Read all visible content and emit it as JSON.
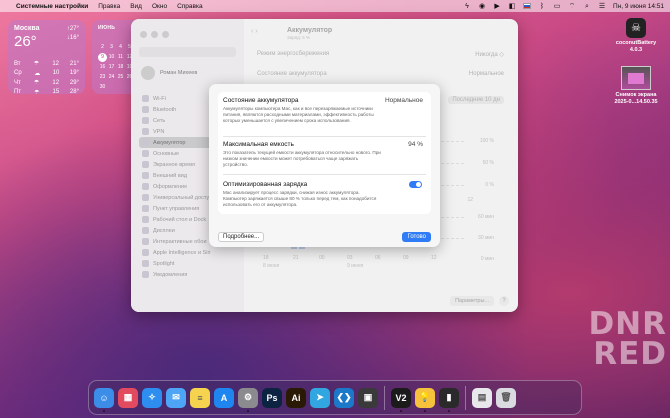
{
  "menubar": {
    "app_name": "Системные настройки",
    "items": [
      "Правка",
      "Вид",
      "Окно",
      "Справка"
    ],
    "datetime": "Пн, 9 июня  14:51",
    "status_icons": [
      "bolt-icon",
      "sphere-icon",
      "play-icon",
      "control-icon",
      "flag-icon",
      "bluetooth-icon",
      "battery-icon",
      "wifi-icon",
      "search-icon",
      "control-center-icon"
    ]
  },
  "weather": {
    "city": "Москва",
    "temp": "26°",
    "hi": "↑27°",
    "lo": "↓16°",
    "rows": [
      {
        "day": "Вт",
        "icon": "cloud-rain-icon",
        "lo": "12",
        "hi": "21°"
      },
      {
        "day": "Ср",
        "icon": "cloud-sun-icon",
        "lo": "10",
        "hi": "19°"
      },
      {
        "day": "Чт",
        "icon": "cloud-rain-icon",
        "lo": "12",
        "hi": "29°"
      },
      {
        "day": "Пт",
        "icon": "cloud-rain-icon",
        "lo": "15",
        "hi": "28°"
      }
    ]
  },
  "calendar": {
    "month": "ИЮНЬ",
    "today": "9",
    "days": [
      "",
      "",
      "",
      "",
      "",
      "",
      "1",
      "2",
      "3",
      "4",
      "5",
      "6",
      "7",
      "8",
      "9",
      "10",
      "11",
      "12",
      "13",
      "14",
      "15",
      "16",
      "17",
      "18",
      "19",
      "20",
      "21",
      "22",
      "23",
      "24",
      "25",
      "26",
      "27",
      "28",
      "29",
      "30"
    ]
  },
  "desktop": {
    "coconut_label": "coconutBattery",
    "coconut_version": "4.0.3",
    "screenshot_label": "Снимок экрана",
    "screenshot_sub": "2025-0...14.50.35"
  },
  "window": {
    "title": "Аккумулятор",
    "subtitle": "Заряд: 6 %",
    "profile_name": "Роман Михеев",
    "sidebar_items": [
      "Wi-Fi",
      "Bluetooth",
      "Сеть",
      "VPN",
      "Аккумулятор",
      "Основные",
      "Экранное время",
      "Внешний вид",
      "Оформление",
      "Универсальный доступ",
      "Пункт управления",
      "Рабочий стол и Dock",
      "Дисплеи",
      "Интерактивные обои",
      "Apple Intelligence и Siri",
      "Spotlight",
      "Уведомления"
    ],
    "active_item": "Аккумулятор",
    "row1_label": "Режим энергосбережения",
    "row1_value": "Никогда ◇",
    "row2_label": "Состояние аккумулятора",
    "row2_value": "Нормальное",
    "tabs_label": "Последние 10 дн",
    "pct_labels": [
      "100 %",
      "50 %",
      "0 %",
      "12",
      "60 мин",
      "30 мин",
      "0 мин"
    ],
    "x_labels": [
      "18",
      "21",
      "00",
      "03",
      "06",
      "09",
      "12"
    ],
    "x_sub": "8 июня",
    "x_sub2": "9 июня",
    "params_label": "Параметры...",
    "help_label": "?"
  },
  "sheet": {
    "health_title": "Состояние аккумулятора",
    "health_value": "Нормальное",
    "health_desc": "Аккумуляторы компьютера Mac, как и все перезаряжаемые источники питания, являются расходными материалами, эффективность работы которых уменьшается с увеличением срока использования.",
    "capacity_title": "Максимальная емкость",
    "capacity_value": "94 %",
    "capacity_desc": "Это показатель текущей емкости аккумулятора относительно нового. При низком значении емкости может потребоваться чаще заряжать устройство.",
    "optimized_title": "Оптимизированная зарядка",
    "optimized_desc": "Mac анализирует процесс зарядки, снижая износ аккумулятора. Компьютер заряжается свыше 80 % только перед тем, как понадобится использовать его от аккумулятора.",
    "optimized_on": true,
    "more_label": "Подробнее...",
    "done_label": "Готово"
  },
  "dock": {
    "apps": [
      {
        "name": "finder-icon",
        "color": "#3b8de8",
        "glyph": "☺"
      },
      {
        "name": "launchpad-icon",
        "color": "#e24b5f",
        "glyph": "▦"
      },
      {
        "name": "safari-icon",
        "color": "#2d8ef0",
        "glyph": "✧"
      },
      {
        "name": "mail-icon",
        "color": "#4ea4f5",
        "glyph": "✉"
      },
      {
        "name": "notes-icon",
        "color": "#f5d34e",
        "glyph": "≡"
      },
      {
        "name": "app-store-icon",
        "color": "#1f86f0",
        "glyph": "A"
      },
      {
        "name": "system-settings-icon",
        "color": "#8a8a8f",
        "glyph": "⚙"
      },
      {
        "name": "photoshop-icon",
        "color": "#0c2342",
        "glyph": "Ps"
      },
      {
        "name": "illustrator-icon",
        "color": "#2a1a05",
        "glyph": "Ai"
      },
      {
        "name": "telegram-icon",
        "color": "#32a6e0",
        "glyph": "➤"
      },
      {
        "name": "vscode-icon",
        "color": "#1c78c8",
        "glyph": "❮❯"
      },
      {
        "name": "pdf-reader-icon",
        "color": "#3a3a3a",
        "glyph": "▣"
      }
    ],
    "recent": [
      {
        "name": "v2-app-icon",
        "color": "#1b1b1b",
        "glyph": "V2"
      },
      {
        "name": "bulb-app-icon",
        "color": "#f6c23b",
        "glyph": "💡"
      },
      {
        "name": "coconut-battery-icon",
        "color": "#2a2a2a",
        "glyph": "▮"
      }
    ],
    "trailing": [
      {
        "name": "downloads-folder-icon",
        "color": "#e8e8ec",
        "glyph": "▤"
      },
      {
        "name": "trash-icon",
        "color": "#d9dbe0",
        "glyph": "🗑"
      }
    ]
  },
  "watermark": {
    "line1": "DNR",
    "line2": "RED"
  }
}
